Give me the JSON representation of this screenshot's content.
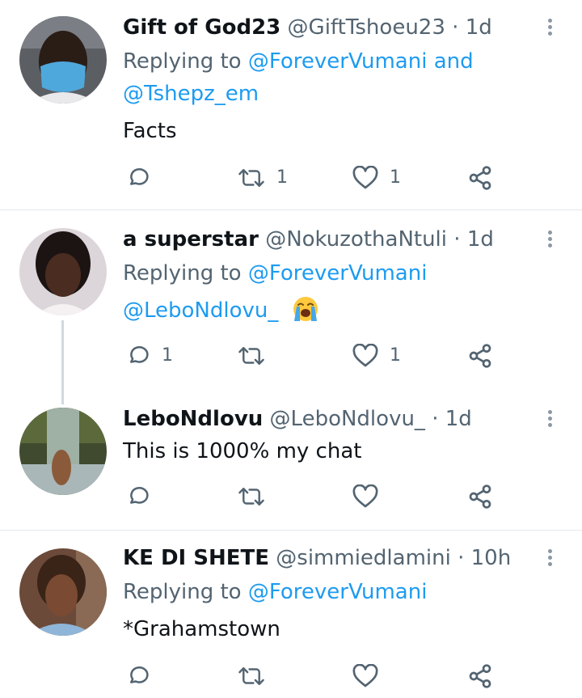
{
  "tweets": [
    {
      "display_name": "Gift of God23",
      "handle": "@GiftTshoeu23",
      "separator": "·",
      "time": "1d",
      "replying_prefix": "Replying to",
      "mention_1": "@ForeverVumani",
      "mention_joiner": "and",
      "mention_2": "@Tshepz_em",
      "text": "Facts",
      "replies": "",
      "retweets": "1",
      "likes": "1"
    },
    {
      "display_name": "a superstar",
      "handle": "@NokuzothaNtuli",
      "separator": "·",
      "time": "1d",
      "replying_prefix": "Replying to",
      "mention_1": "@ForeverVumani",
      "text_mention": "@LeboNdlovu_",
      "emoji": "loudly-crying-face",
      "replies": "1",
      "retweets": "",
      "likes": "1"
    },
    {
      "display_name": "LeboNdlovu",
      "handle": "@LeboNdlovu_",
      "separator": "·",
      "time": "1d",
      "text": "This is 1000% my chat",
      "replies": "",
      "retweets": "",
      "likes": ""
    },
    {
      "display_name": "KE DI SHETE",
      "handle": "@simmiedlamini",
      "separator": "·",
      "time": "10h",
      "replying_prefix": "Replying to",
      "mention_1": "@ForeverVumani",
      "text": "*Grahamstown",
      "replies": "",
      "retweets": "",
      "likes": ""
    }
  ],
  "icons": {
    "reply": "reply-icon",
    "retweet": "retweet-icon",
    "like": "heart-icon",
    "share": "share-icon",
    "more": "more-vertical-icon"
  },
  "colors": {
    "link": "#1d9bf0",
    "secondary_text": "#536471",
    "primary_text": "#0f1419",
    "divider": "#e1e8ed"
  }
}
